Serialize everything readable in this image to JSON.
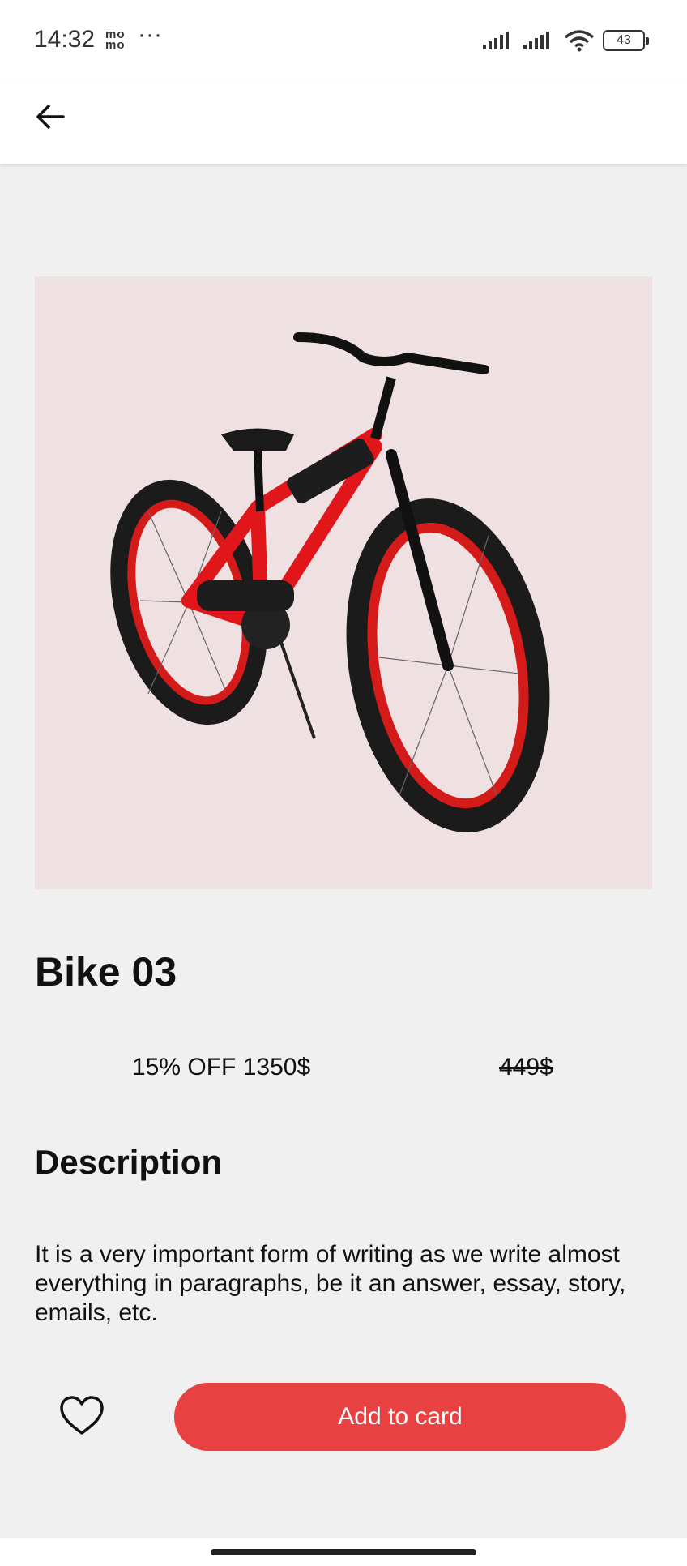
{
  "status_bar": {
    "time": "14:32",
    "carrier_icon_text": "mo mo",
    "more": "···",
    "battery": "43"
  },
  "app_bar": {
    "back_icon": "arrow-left-icon"
  },
  "product": {
    "image_icon": "bicycle-image",
    "title": "Bike 03",
    "discount_price": "15% OFF 1350$",
    "old_price": "449$",
    "description_heading": "Description",
    "description": "It is a very important form of writing as we write almost everything in paragraphs, be it an answer, essay, story, emails, etc."
  },
  "actions": {
    "favorite_icon": "heart-outline-icon",
    "add_to_cart_label": "Add to card",
    "accent_color": "#e84141"
  }
}
